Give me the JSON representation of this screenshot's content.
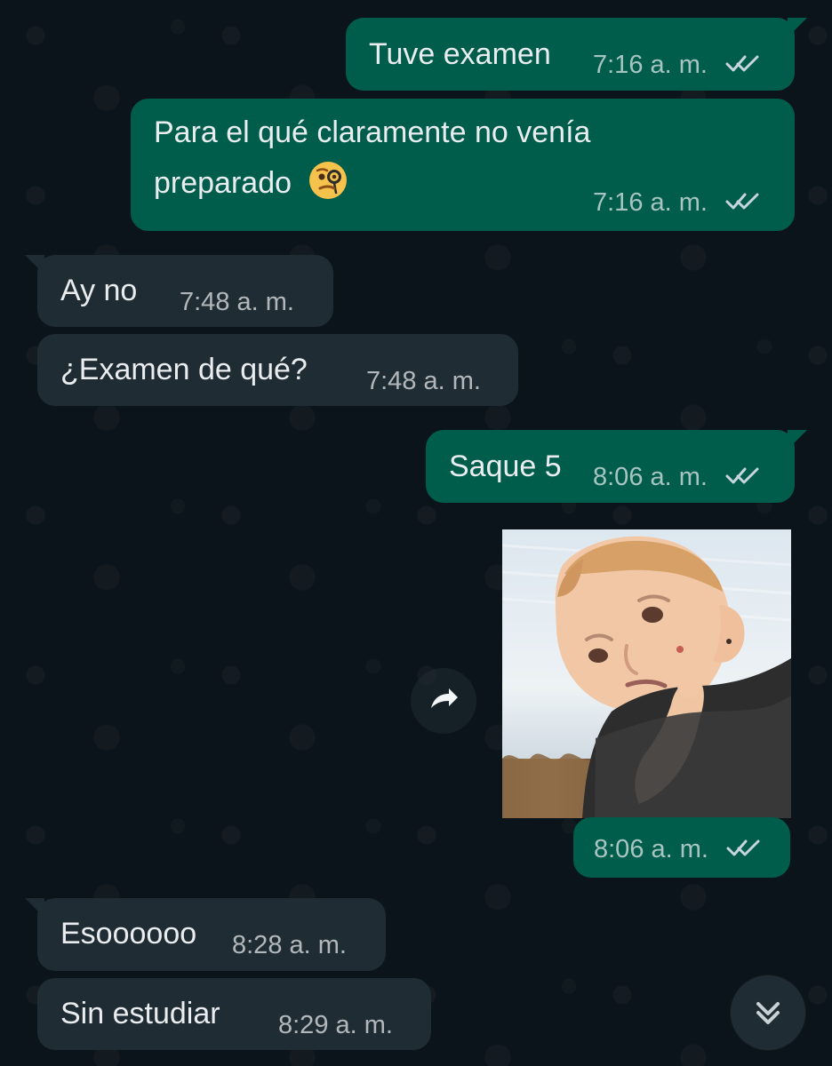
{
  "messages": [
    {
      "text": "Tuve examen",
      "time": "7:16 a. m."
    },
    {
      "text_line1": "Para el qué claramente no venía",
      "text_line2": "preparado",
      "time": "7:16 a. m."
    },
    {
      "text": "Ay no",
      "time": "7:48 a. m."
    },
    {
      "text": "¿Examen de qué?",
      "time": "7:48 a. m."
    },
    {
      "text": "Saque 5",
      "time": "8:06 a. m."
    },
    {
      "time": "8:06 a. m."
    },
    {
      "text": "Esoooooo",
      "time": "8:28 a. m."
    },
    {
      "text": "Sin estudiar",
      "time": "8:29 a. m."
    }
  ],
  "icons": {
    "double_check": "double-check-icon",
    "emoji": "monocle-face-emoji",
    "forward": "forward-icon",
    "scroll_down": "double-chevron-down-icon"
  },
  "colors": {
    "background": "#0b141a",
    "outgoing_bubble": "#005c4b",
    "incoming_bubble": "#202c33",
    "text": "#e9edef",
    "secondary_text": "#9fb2bb",
    "tick": "#c7d6dc"
  }
}
